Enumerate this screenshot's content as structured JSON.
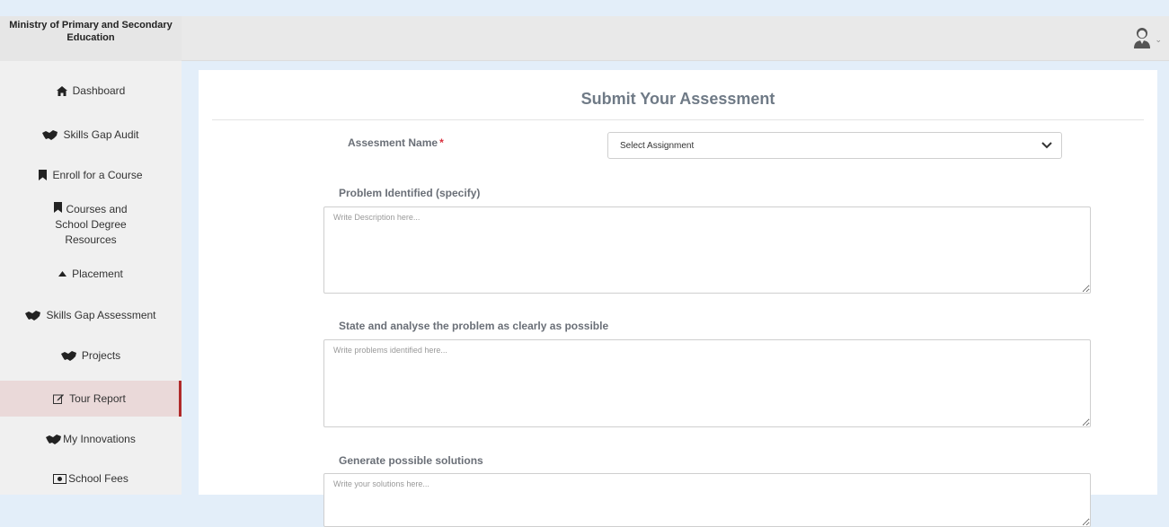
{
  "sidebar": {
    "brand": "Ministry of Primary and Secondary Education",
    "items": [
      {
        "label": "Dashboard",
        "icon": "home-icon"
      },
      {
        "label": "Skills Gap Audit",
        "icon": "handshake-icon"
      },
      {
        "label": "Enroll for a Course",
        "icon": "bookmark-icon"
      },
      {
        "label": "Courses and School Degree Resources",
        "icon": "bookmark-icon"
      },
      {
        "label": "Placement",
        "icon": "caret-up-icon"
      },
      {
        "label": "Skills Gap Assessment",
        "icon": "handshake-icon"
      },
      {
        "label": "Projects",
        "icon": "handshake-icon"
      },
      {
        "label": "Tour Report",
        "icon": "edit-icon",
        "active": true
      },
      {
        "label": "My Innovations",
        "icon": "handshake-icon"
      },
      {
        "label": "School Fees",
        "icon": "money-icon"
      }
    ]
  },
  "header": {
    "user_icon": "user-avatar-icon"
  },
  "form": {
    "title": "Submit Your Assessment",
    "assessment_label": "Assesment Name",
    "required_mark": "*",
    "select_value": "Select Assignment",
    "problem_label": "Problem Identified (specify)",
    "problem_placeholder": "Write Description here...",
    "analyse_label": "State and analyse the problem as clearly as possible",
    "analyse_placeholder": "Write problems identified here...",
    "solutions_label": "Generate possible solutions",
    "solutions_placeholder": "Write your solutions here..."
  },
  "colors": {
    "accent": "#b02a2a",
    "background": "#e3eef9",
    "title": "#6f7a86"
  }
}
